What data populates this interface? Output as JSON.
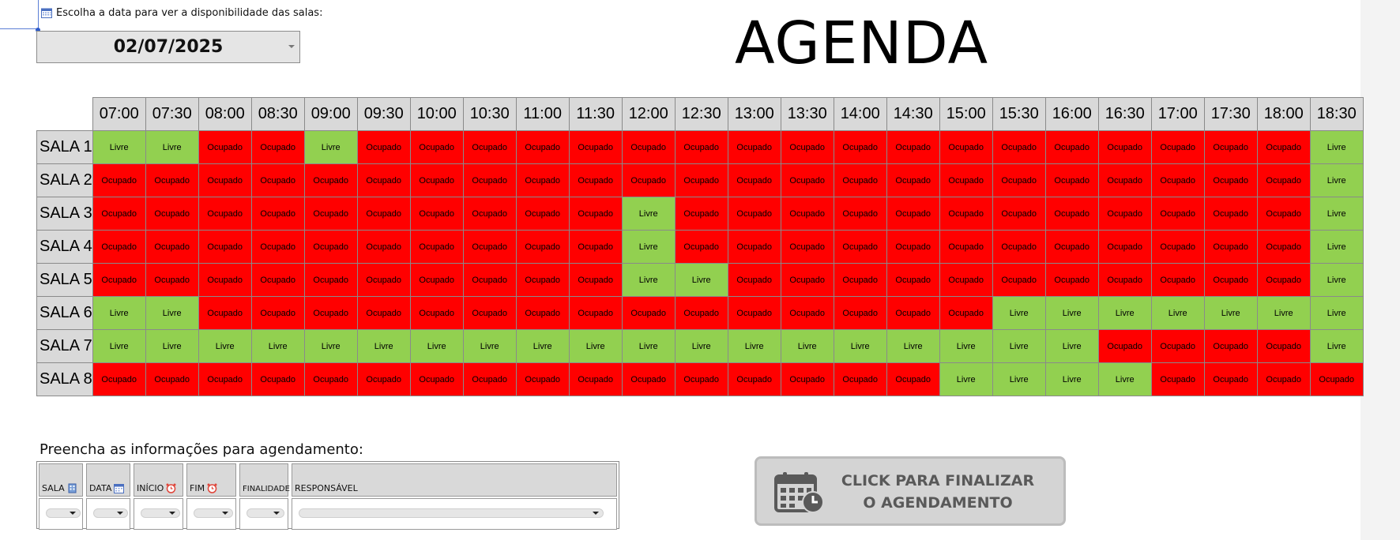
{
  "date_selector": {
    "label": "Escolha a data para ver a disponibilidade das salas:",
    "value": "02/07/2025"
  },
  "title": "AGENDA",
  "times": [
    "07:00",
    "07:30",
    "08:00",
    "08:30",
    "09:00",
    "09:30",
    "10:00",
    "10:30",
    "11:00",
    "11:30",
    "12:00",
    "12:30",
    "13:00",
    "13:30",
    "14:00",
    "14:30",
    "15:00",
    "15:30",
    "16:00",
    "16:30",
    "17:00",
    "17:30",
    "18:00",
    "18:30"
  ],
  "status_labels": {
    "L": "Livre",
    "O": "Ocupado"
  },
  "rooms": [
    {
      "name": "SALA 1",
      "slots": "LLOOLOOOOOOOOOOOOOOOOOOL"
    },
    {
      "name": "SALA 2",
      "slots": "OOOOOOOOOOOOOOOOOOOOOOOL"
    },
    {
      "name": "SALA 3",
      "slots": "OOOOOOOOOOLOOOOOOOOOOOOL"
    },
    {
      "name": "SALA 4",
      "slots": "OOOOOOOOOOLOOOOOOOOOOOOL"
    },
    {
      "name": "SALA 5",
      "slots": "OOOOOOOOOOLLOOOOOOOOOOOL"
    },
    {
      "name": "SALA 6",
      "slots": "LLOOOOOOOOOOOOOOOLLLLLLL"
    },
    {
      "name": "SALA 7",
      "slots": "LLLLLLLLLLLLLLLLLLLOOOOL"
    },
    {
      "name": "SALA 8",
      "slots": "OOOOOOOOOOOOOOOOLLLLOOOO"
    }
  ],
  "colors": {
    "livre": "#92d050",
    "ocupado": "#ff0000",
    "header": "#d9d9d9"
  },
  "form": {
    "title": "Preencha as informações para agendamento:",
    "columns": [
      {
        "label": "SALA",
        "icon": "building-icon"
      },
      {
        "label": "DATA",
        "icon": "calendar-icon"
      },
      {
        "label": "INÍCIO",
        "icon": "alarm-clock-icon"
      },
      {
        "label": "FIM",
        "icon": "alarm-clock-icon"
      },
      {
        "label": "FINALIDADE",
        "icon": ""
      },
      {
        "label": "RESPONSÁVEL",
        "icon": ""
      }
    ]
  },
  "finalize_button": {
    "line1": "CLICK PARA FINALIZAR",
    "line2": "O AGENDAMENTO",
    "icon": "calendar-clock-icon"
  }
}
